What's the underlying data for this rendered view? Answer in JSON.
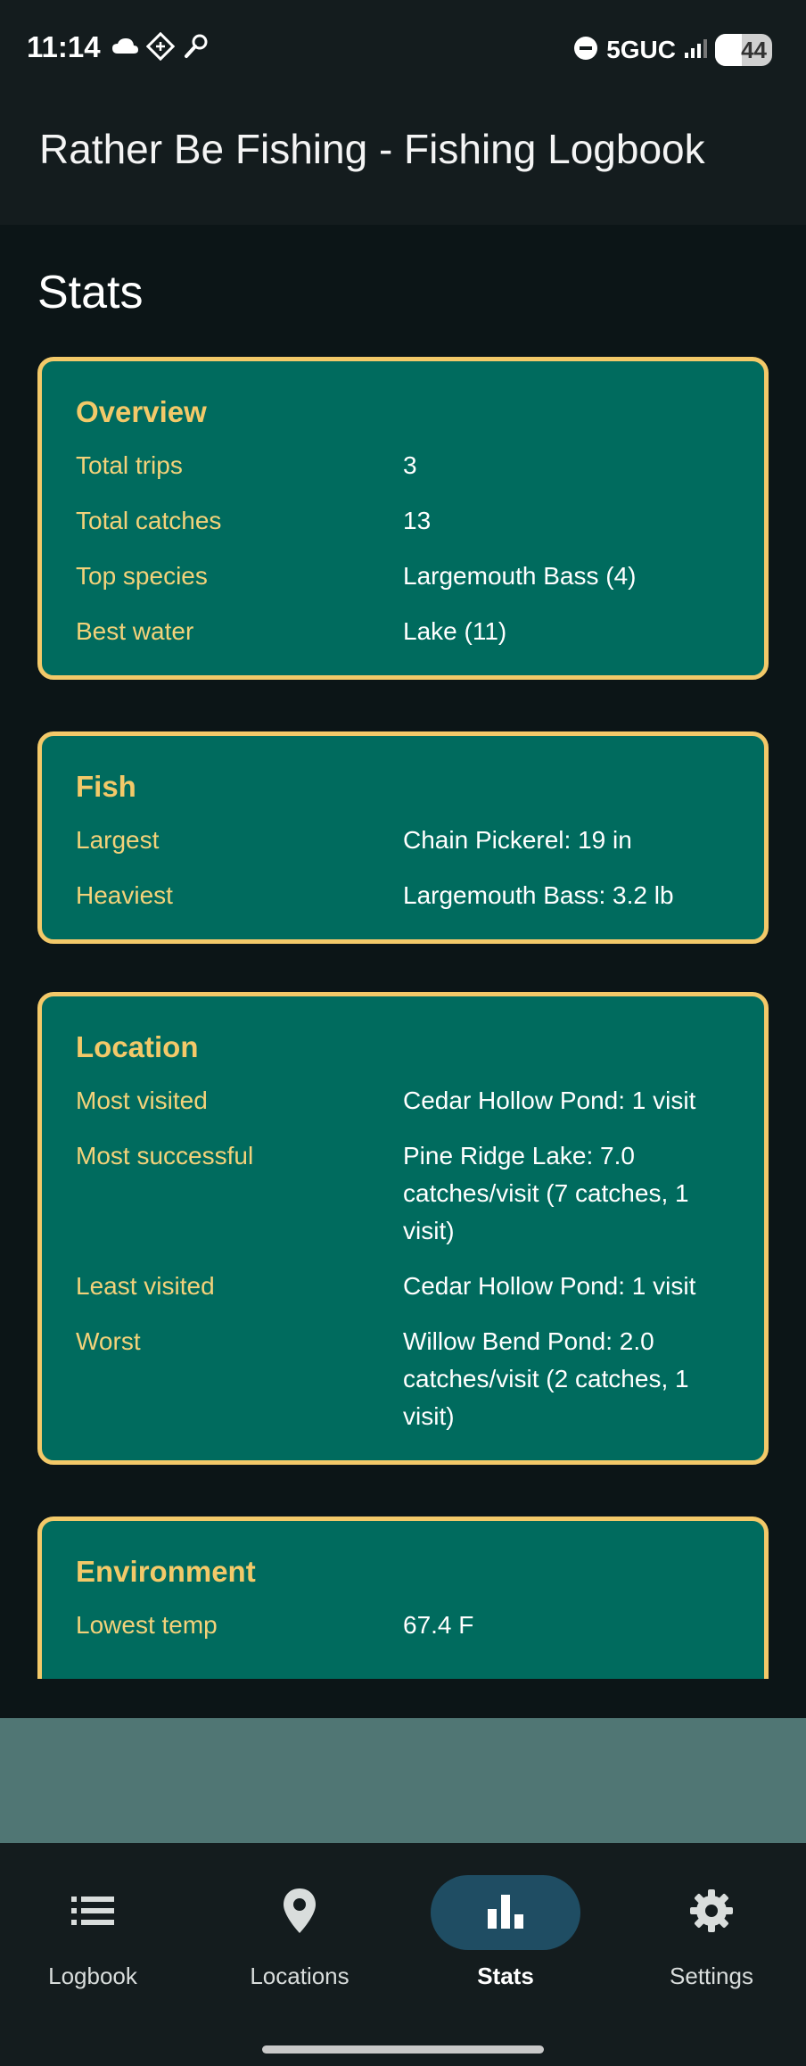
{
  "status_bar": {
    "time": "11:14",
    "network": "5GUC",
    "battery": "44",
    "left_icons": [
      "cloud-icon",
      "vpn-icon",
      "wrench-icon"
    ],
    "right_icons": [
      "dnd-icon",
      "signal-icon",
      "battery-icon"
    ]
  },
  "app_bar": {
    "title": "Rather Be Fishing - Fishing Logbook"
  },
  "page": {
    "heading": "Stats"
  },
  "colors": {
    "card_bg": "#006b5e",
    "card_border": "#f3c969",
    "label": "#f3d27a",
    "nav_active_bg": "#1f4d63"
  },
  "cards": {
    "overview": {
      "title": "Overview",
      "rows": [
        {
          "label": "Total trips",
          "value": "3"
        },
        {
          "label": "Total catches",
          "value": "13"
        },
        {
          "label": "Top species",
          "value": "Largemouth Bass (4)"
        },
        {
          "label": "Best water",
          "value": "Lake (11)"
        }
      ]
    },
    "fish": {
      "title": "Fish",
      "rows": [
        {
          "label": "Largest",
          "value": "Chain Pickerel: 19 in"
        },
        {
          "label": "Heaviest",
          "value": "Largemouth Bass: 3.2 lb"
        }
      ]
    },
    "location": {
      "title": "Location",
      "rows": [
        {
          "label": "Most visited",
          "value": "Cedar Hollow Pond: 1 visit"
        },
        {
          "label": "Most successful",
          "value": "Pine Ridge Lake: 7.0 catches/visit (7 catches, 1 visit)"
        },
        {
          "label": "Least visited",
          "value": "Cedar Hollow Pond: 1 visit"
        },
        {
          "label": "Worst",
          "value": "Willow Bend Pond: 2.0 catches/visit (2 catches, 1 visit)"
        }
      ]
    },
    "environment": {
      "title": "Environment",
      "rows": [
        {
          "label": "Lowest temp",
          "value": "67.4 F"
        }
      ]
    }
  },
  "nav": {
    "items": [
      {
        "label": "Logbook",
        "icon": "list-icon"
      },
      {
        "label": "Locations",
        "icon": "location-pin-icon"
      },
      {
        "label": "Stats",
        "icon": "bar-chart-icon",
        "active": true
      },
      {
        "label": "Settings",
        "icon": "gear-icon"
      }
    ]
  }
}
